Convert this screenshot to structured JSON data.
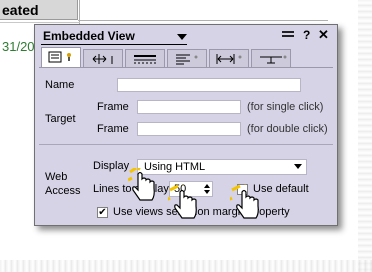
{
  "background": {
    "header_text": "eated",
    "date_text": "31/20"
  },
  "dialog": {
    "title": "Embedded View",
    "help_label": "?",
    "close_label": "✕"
  },
  "tabs": [
    {
      "name": "tab-info",
      "icon": "info-icon",
      "active": true
    },
    {
      "name": "tab-size",
      "icon": "size-icon",
      "active": false
    },
    {
      "name": "tab-border",
      "icon": "border-icon",
      "active": false
    },
    {
      "name": "tab-paragraph",
      "icon": "paragraph-icon",
      "active": false
    },
    {
      "name": "tab-width",
      "icon": "width-icon",
      "active": false
    },
    {
      "name": "tab-hide",
      "icon": "hide-when-icon",
      "active": false
    }
  ],
  "fields": {
    "name_label": "Name",
    "target_label": "Target",
    "frame_label_1": "Frame",
    "frame_label_2": "Frame",
    "frame_hint_1": "(for single click)",
    "frame_hint_2": "(for double click)",
    "web_access_label_1": "Web",
    "web_access_label_2": "Access",
    "display_label": "Display",
    "display_value": "Using HTML",
    "lines_label": "Lines to display",
    "lines_value": "50",
    "use_default_label": "Use default",
    "use_default_checked": false,
    "margin_label": "Use views selection margin property",
    "margin_checked": true
  },
  "colors": {
    "dialog_bg": "#d6d3e6",
    "cursor_highlight": "#f5c400"
  }
}
